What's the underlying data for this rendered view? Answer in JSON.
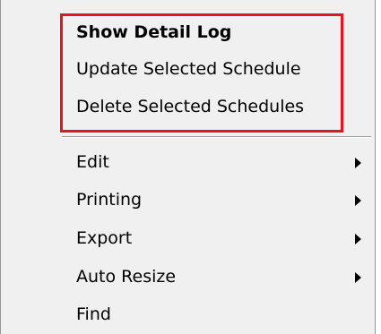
{
  "menu": {
    "items": [
      {
        "label": "Show Detail Log",
        "bold": true,
        "submenu": false
      },
      {
        "label": "Update Selected Schedule",
        "bold": false,
        "submenu": false
      },
      {
        "label": "Delete Selected Schedules",
        "bold": false,
        "submenu": false
      },
      {
        "label": "Edit",
        "bold": false,
        "submenu": true
      },
      {
        "label": "Printing",
        "bold": false,
        "submenu": true
      },
      {
        "label": "Export",
        "bold": false,
        "submenu": true
      },
      {
        "label": "Auto Resize",
        "bold": false,
        "submenu": true
      },
      {
        "label": "Find",
        "bold": false,
        "submenu": false
      }
    ]
  },
  "colors": {
    "menu_background": "#f0f0f0",
    "highlight_border": "#e8141b",
    "text": "#000000"
  },
  "icons": {
    "submenu": "submenu-arrow-icon"
  }
}
